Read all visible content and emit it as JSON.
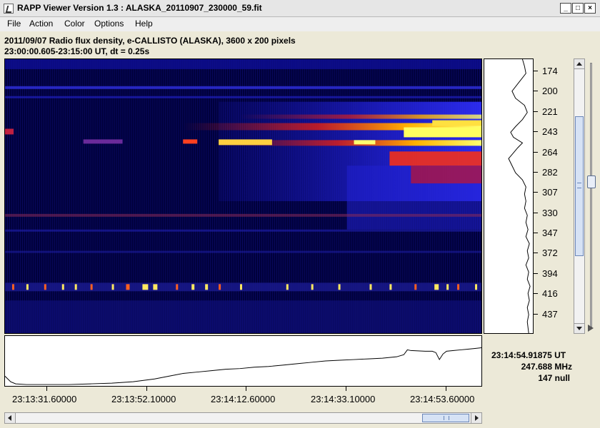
{
  "window": {
    "title": "RAPP Viewer Version 1.3 : ALASKA_20110907_230000_59.fit",
    "minimize_glyph": "_",
    "maximize_glyph": "□",
    "close_glyph": "×"
  },
  "menu": [
    "File",
    "Action",
    "Color",
    "Options",
    "Help"
  ],
  "info": {
    "line1": "2011/09/07  Radio flux density, e-CALLISTO (ALASKA),  3600 x 200 pixels",
    "line2": "23:00:00.605-23:15:00 UT,  dt = 0.25s"
  },
  "frequency_axis": {
    "labels": [
      "174",
      "200",
      "221",
      "243",
      "264",
      "282",
      "307",
      "330",
      "347",
      "372",
      "394",
      "416",
      "437"
    ]
  },
  "time_axis": {
    "labels": [
      "23:13:31.60000",
      "23:13:52.10000",
      "23:14:12.60000",
      "23:14:33.10000",
      "23:14:53.60000"
    ]
  },
  "cursor_readout": {
    "time": "23:14:54.91875 UT",
    "frequency": "247.688 MHz",
    "value": "147 null"
  },
  "colors": {
    "spectrogram_background": "#00003a",
    "burst_hot": "#ffff60",
    "burst_mid": "#ff2000",
    "burst_low": "#2020e0"
  }
}
